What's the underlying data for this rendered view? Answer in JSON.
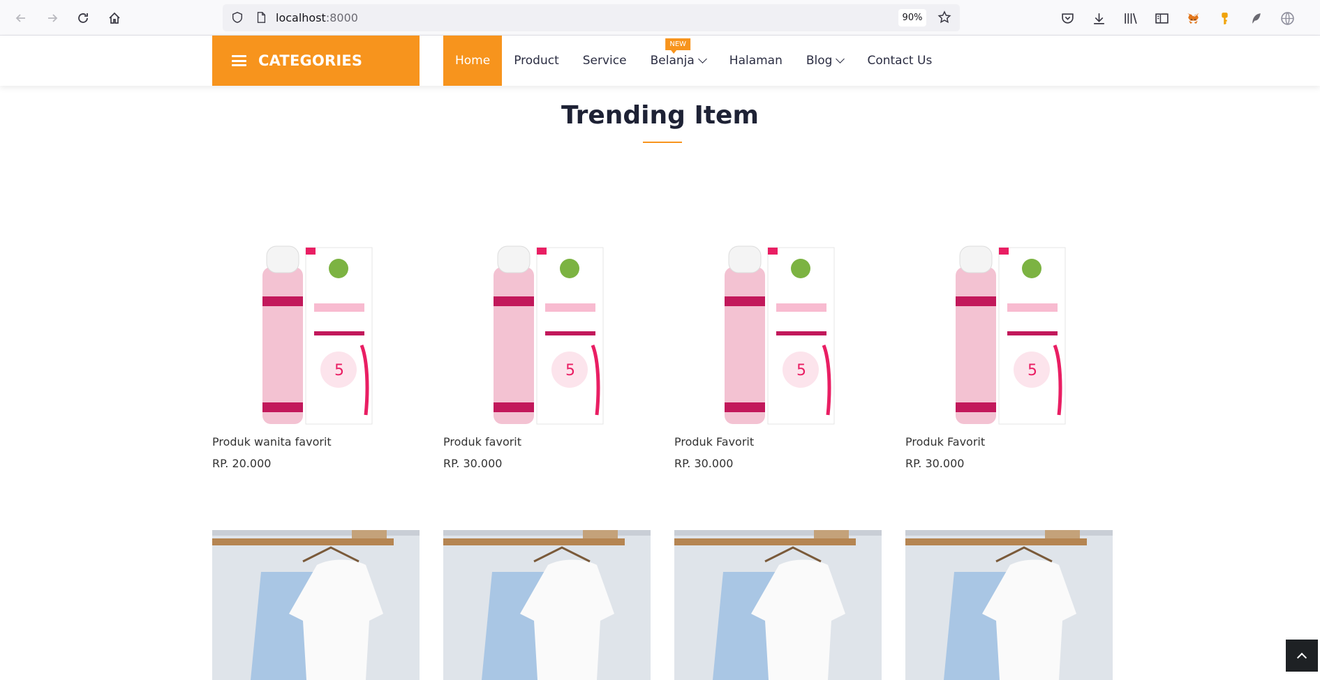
{
  "browser": {
    "url_host": "localhost",
    "url_port": ":8000",
    "zoom": "90%"
  },
  "header": {
    "categories_label": "CATEGORIES",
    "menu": [
      {
        "label": "Home",
        "active": true
      },
      {
        "label": "Product"
      },
      {
        "label": "Service"
      },
      {
        "label": "Belanja",
        "badge": "NEW",
        "dropdown": true
      },
      {
        "label": "Halaman"
      },
      {
        "label": "Blog",
        "dropdown": true
      },
      {
        "label": "Contact Us"
      }
    ]
  },
  "section": {
    "title": "Trending Item"
  },
  "products": [
    {
      "name": "Produk wanita favorit",
      "price": "RP. 20.000",
      "image": "serum-bottle-box"
    },
    {
      "name": "Produk favorit",
      "price": "RP. 30.000",
      "image": "serum-bottle-box"
    },
    {
      "name": "Produk Favorit",
      "price": "RP. 30.000",
      "image": "serum-bottle-box"
    },
    {
      "name": "Produk Favorit",
      "price": "RP. 30.000",
      "image": "serum-bottle-box"
    }
  ],
  "second_row": [
    {
      "image": "clothes-on-hanger"
    },
    {
      "image": "clothes-on-hanger"
    },
    {
      "image": "clothes-on-hanger"
    },
    {
      "image": "clothes-on-hanger"
    }
  ],
  "colors": {
    "accent": "#f7941d",
    "heading": "#1e2235"
  }
}
